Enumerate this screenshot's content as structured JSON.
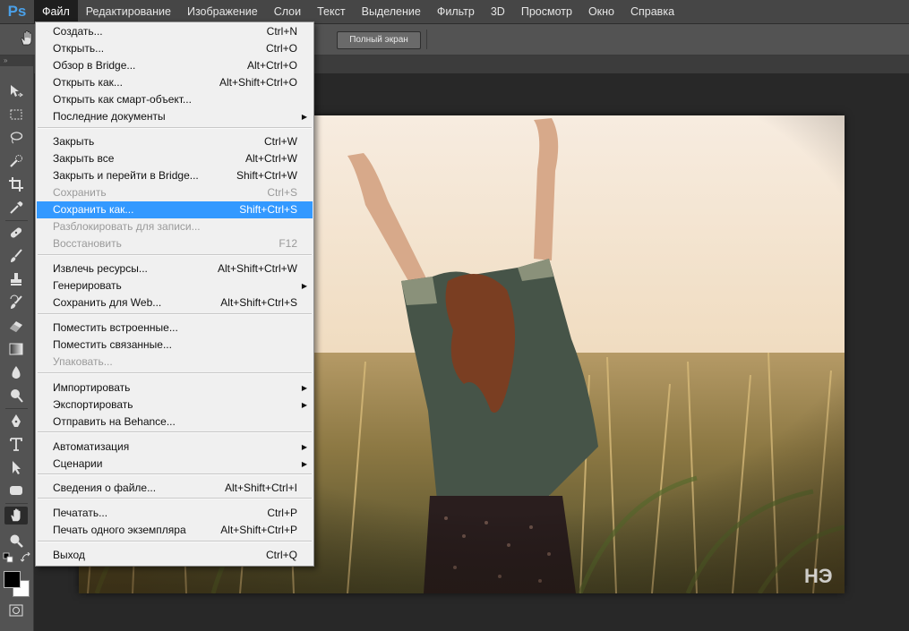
{
  "app": {
    "logo": "Ps"
  },
  "menubar": {
    "items": [
      "Файл",
      "Редактирование",
      "Изображение",
      "Слои",
      "Текст",
      "Выделение",
      "Фильтр",
      "3D",
      "Просмотр",
      "Окно",
      "Справка"
    ],
    "active_index": 0
  },
  "options_bar": {
    "fullscreen_label": "Полный экран"
  },
  "file_menu": {
    "items": [
      {
        "label": "Создать...",
        "shortcut": "Ctrl+N"
      },
      {
        "label": "Открыть...",
        "shortcut": "Ctrl+O"
      },
      {
        "label": "Обзор в Bridge...",
        "shortcut": "Alt+Ctrl+O"
      },
      {
        "label": "Открыть как...",
        "shortcut": "Alt+Shift+Ctrl+O"
      },
      {
        "label": "Открыть как смарт-объект...",
        "shortcut": ""
      },
      {
        "label": "Последние документы",
        "shortcut": "",
        "submenu": true
      },
      {
        "label": "Закрыть",
        "shortcut": "Ctrl+W"
      },
      {
        "label": "Закрыть все",
        "shortcut": "Alt+Ctrl+W"
      },
      {
        "label": "Закрыть и перейти в Bridge...",
        "shortcut": "Shift+Ctrl+W"
      },
      {
        "label": "Сохранить",
        "shortcut": "Ctrl+S",
        "disabled": true
      },
      {
        "label": "Сохранить как...",
        "shortcut": "Shift+Ctrl+S",
        "highlighted": true
      },
      {
        "label": "Разблокировать для записи...",
        "shortcut": "",
        "disabled": true
      },
      {
        "label": "Восстановить",
        "shortcut": "F12",
        "disabled": true
      },
      {
        "label": "Извлечь ресурсы...",
        "shortcut": "Alt+Shift+Ctrl+W"
      },
      {
        "label": "Генерировать",
        "shortcut": "",
        "submenu": true
      },
      {
        "label": "Сохранить для Web...",
        "shortcut": "Alt+Shift+Ctrl+S"
      },
      {
        "label": "Поместить встроенные...",
        "shortcut": ""
      },
      {
        "label": "Поместить связанные...",
        "shortcut": ""
      },
      {
        "label": "Упаковать...",
        "shortcut": "",
        "disabled": true
      },
      {
        "label": "Импортировать",
        "shortcut": "",
        "submenu": true
      },
      {
        "label": "Экспортировать",
        "shortcut": "",
        "submenu": true
      },
      {
        "label": "Отправить на Behance...",
        "shortcut": ""
      },
      {
        "label": "Автоматизация",
        "shortcut": "",
        "submenu": true
      },
      {
        "label": "Сценарии",
        "shortcut": "",
        "submenu": true
      },
      {
        "label": "Сведения о файле...",
        "shortcut": "Alt+Shift+Ctrl+I"
      },
      {
        "label": "Печатать...",
        "shortcut": "Ctrl+P"
      },
      {
        "label": "Печать одного экземпляра",
        "shortcut": "Alt+Shift+Ctrl+P"
      },
      {
        "label": "Выход",
        "shortcut": "Ctrl+Q"
      }
    ]
  },
  "toolbox": {
    "tools": [
      "move-icon",
      "marquee-icon",
      "lasso-icon",
      "quick-select-icon",
      "crop-icon",
      "eyedropper-icon",
      "healing-brush-icon",
      "brush-icon",
      "stamp-icon",
      "history-brush-icon",
      "eraser-icon",
      "gradient-icon",
      "blur-icon",
      "dodge-icon",
      "pen-icon",
      "type-icon",
      "path-select-icon",
      "shape-icon",
      "hand-icon",
      "zoom-icon"
    ],
    "selected": "hand-icon"
  },
  "canvas": {
    "watermark": "HЭ"
  },
  "colors": {
    "accent": "#3399ff",
    "menu_bg": "#f0f0f0",
    "ui_dark": "#535353"
  }
}
